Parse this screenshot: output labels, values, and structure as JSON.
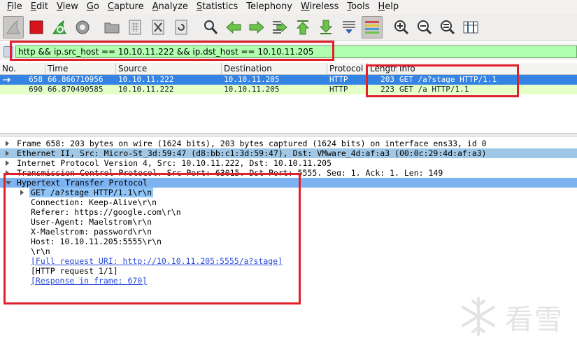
{
  "menu": [
    {
      "label": "File",
      "u": "F",
      "rest": "ile"
    },
    {
      "label": "Edit",
      "u": "E",
      "rest": "dit"
    },
    {
      "label": "View",
      "u": "V",
      "rest": "iew"
    },
    {
      "label": "Go",
      "u": "G",
      "rest": "o"
    },
    {
      "label": "Capture",
      "u": "C",
      "rest": "apture"
    },
    {
      "label": "Analyze",
      "u": "A",
      "rest": "nalyze"
    },
    {
      "label": "Statistics",
      "u": "S",
      "rest": "tatistics"
    },
    {
      "label": "Telephony",
      "u": "",
      "rest": "Telephony"
    },
    {
      "label": "Wireless",
      "u": "W",
      "rest": "ireless"
    },
    {
      "label": "Tools",
      "u": "T",
      "rest": "ools"
    },
    {
      "label": "Help",
      "u": "H",
      "rest": "elp"
    }
  ],
  "filter": {
    "value": "http && ip.src_host == 10.10.11.222 && ip.dst_host == 10.10.11.205"
  },
  "packet_list": {
    "columns": [
      "No.",
      "Time",
      "Source",
      "Destination",
      "Protocol",
      "Length",
      "Info"
    ],
    "rows": [
      {
        "no": "658",
        "time": "66.866710956",
        "src": "10.10.11.222",
        "dst": "10.10.11.205",
        "proto": "HTTP",
        "len": "203",
        "info": "GET /a?stage HTTP/1.1"
      },
      {
        "no": "690",
        "time": "66.870490585",
        "src": "10.10.11.222",
        "dst": "10.10.11.205",
        "proto": "HTTP",
        "len": "223",
        "info": "GET /a HTTP/1.1"
      }
    ]
  },
  "details": {
    "frame": "Frame 658: 203 bytes on wire (1624 bits), 203 bytes captured (1624 bits) on interface ens33, id 0",
    "ethernet": "Ethernet II, Src: Micro-St_3d:59:47 (d8:bb:c1:3d:59:47), Dst: VMware_4d:af:a3 (00:0c:29:4d:af:a3)",
    "ip": "Internet Protocol Version 4, Src: 10.10.11.222, Dst: 10.10.11.205",
    "tcp": "Transmission Control Protocol, Src Port: 63015, Dst Port: 5555, Seq: 1, Ack: 1, Len: 149",
    "http": "Hypertext Transfer Protocol",
    "http_lines": [
      "GET /a?stage HTTP/1.1\\r\\n",
      "Connection: Keep-Alive\\r\\n",
      "Referer: https://google.com\\r\\n",
      "User-Agent: Maelstrom\\r\\n",
      "X-Maelstrom: password\\r\\n",
      "Host: 10.10.11.205:5555\\r\\n",
      "\\r\\n",
      "[Full request URI: http://10.10.11.205:5555/a?stage]",
      "[HTTP request 1/1]",
      "[Response in frame: 670]"
    ]
  },
  "watermark": "看雪",
  "colors": {
    "selected_row": "#3584e4",
    "http_row": "#e4ffc7",
    "filter_ok": "#afffaf",
    "annotation": "#e0202a"
  }
}
